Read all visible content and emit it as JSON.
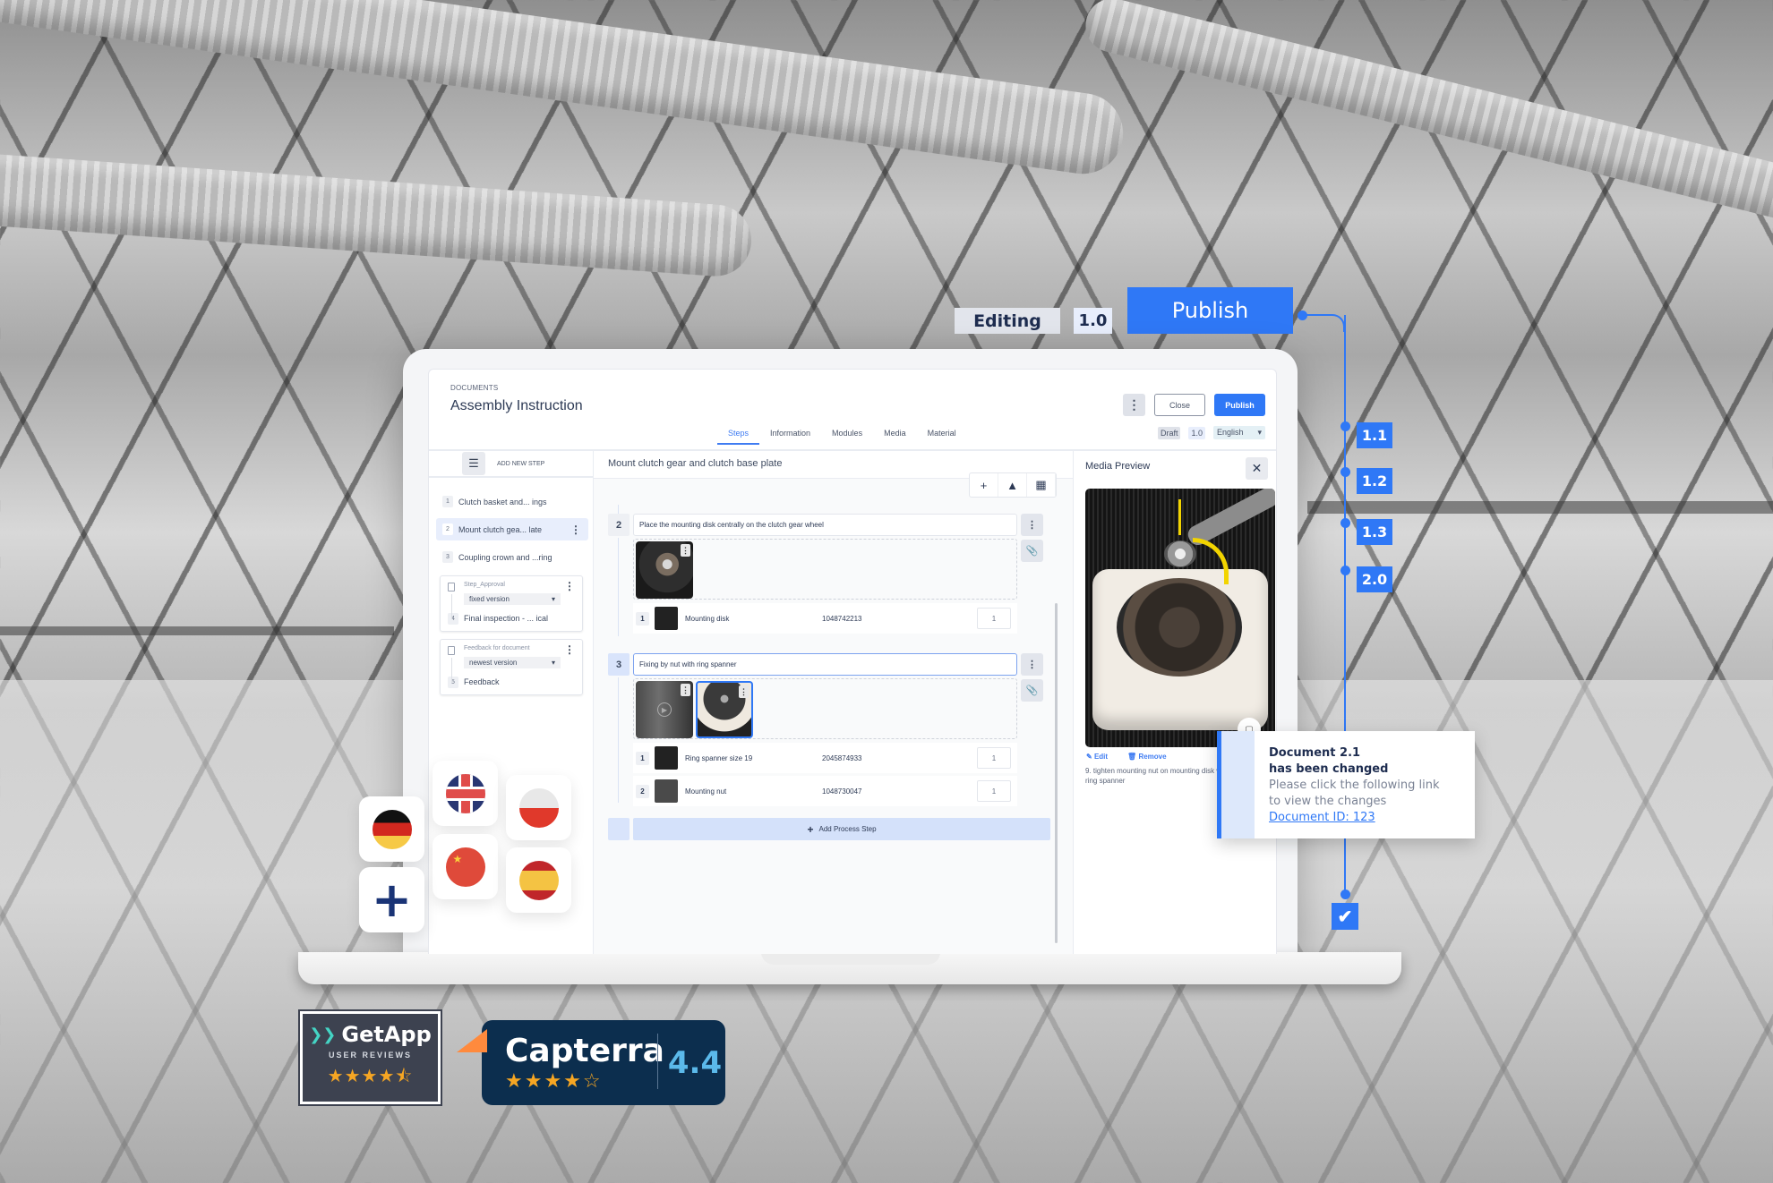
{
  "overlay": {
    "editing_label": "Editing",
    "version_label": "1.0",
    "publish_label": "Publish",
    "version_tags": [
      "1.1",
      "1.2",
      "1.3",
      "2.0"
    ],
    "check_icon": "✔"
  },
  "app": {
    "breadcrumb": "DOCUMENTS",
    "title": "Assembly Instruction",
    "tabs": [
      {
        "label": "Steps",
        "active": true
      },
      {
        "label": "Information"
      },
      {
        "label": "Modules"
      },
      {
        "label": "Media"
      },
      {
        "label": "Material"
      }
    ],
    "header": {
      "more_icon": "⋮",
      "close_label": "Close",
      "publish_label": "Publish",
      "status": "Draft",
      "version": "1.0",
      "language": "English"
    },
    "sidebar": {
      "add_step_label": "ADD NEW STEP",
      "items": [
        {
          "num": "1",
          "label": "Clutch basket and... ings"
        },
        {
          "num": "2",
          "label": "Mount clutch gea... late",
          "selected": true
        },
        {
          "num": "3",
          "label": "Coupling crown and ...ring"
        }
      ],
      "cards": [
        {
          "title": "Step_Approval",
          "select": "fixed version",
          "num": "4",
          "label": "Final inspection - ... ical"
        },
        {
          "title": "Feedback for document",
          "select": "newest version",
          "num": "5",
          "label": "Feedback"
        }
      ]
    },
    "main": {
      "step_title": "Mount clutch gear and clutch base plate",
      "toolbar": {
        "add": "+",
        "warning": "▲",
        "modules": "▦"
      },
      "steps": [
        {
          "num": "2",
          "text": "Place the mounting disk centrally on the clutch gear wheel",
          "materials": [
            {
              "num": "1",
              "name": "Mounting disk",
              "id": "1048742213",
              "qty": "1"
            }
          ]
        },
        {
          "num": "3",
          "text": "Fixing by nut with ring spanner",
          "materials": [
            {
              "num": "1",
              "name": "Ring spanner size 19",
              "id": "2045874933",
              "qty": "1"
            },
            {
              "num": "2",
              "name": "Mounting nut",
              "id": "1048730047",
              "qty": "1"
            }
          ]
        }
      ],
      "add_process_label": "Add Process Step"
    },
    "preview": {
      "title": "Media Preview",
      "close_icon": "✕",
      "edit_label": "Edit",
      "remove_label": "Remove",
      "caption": "9. tighten mounting nut on mounting disk with ring spanner"
    }
  },
  "notification": {
    "title_line1": "Document 2.1",
    "title_line2": "has been changed",
    "body": "Please click the following link to view the changes",
    "link": "Document ID: 123"
  },
  "languages": [
    "German",
    "English (UK)",
    "Polish",
    "Chinese",
    "Spanish",
    "Add language"
  ],
  "badges": {
    "getapp": {
      "name": "GetApp",
      "sub": "USER REVIEWS",
      "rating_stars": 4.5
    },
    "capterra": {
      "name": "Capterra",
      "score": "4.4",
      "rating_stars": 4.5
    }
  }
}
